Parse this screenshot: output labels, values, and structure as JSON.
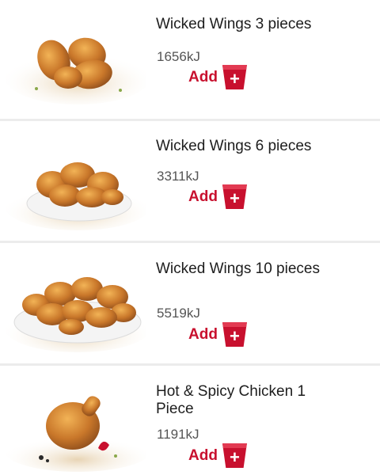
{
  "items": [
    {
      "name": "Wicked Wings 3 pieces",
      "energy": "1656kJ",
      "add_label": "Add",
      "image": "wicked-wings-3-pieces-image"
    },
    {
      "name": "Wicked Wings 6 pieces",
      "energy": "3311kJ",
      "add_label": "Add",
      "image": "wicked-wings-6-pieces-image"
    },
    {
      "name": "Wicked Wings 10 pieces",
      "energy": "5519kJ",
      "add_label": "Add",
      "image": "wicked-wings-10-pieces-image"
    },
    {
      "name": "Hot & Spicy Chicken 1 Piece",
      "energy": "1191kJ",
      "add_label": "Add",
      "image": "hot-spicy-chicken-piece-image"
    }
  ],
  "colors": {
    "brand_red": "#c8102e",
    "separator": "#ececec",
    "text": "#1d1d1d",
    "energy_text": "#555555"
  },
  "add_icon": "plus-icon"
}
